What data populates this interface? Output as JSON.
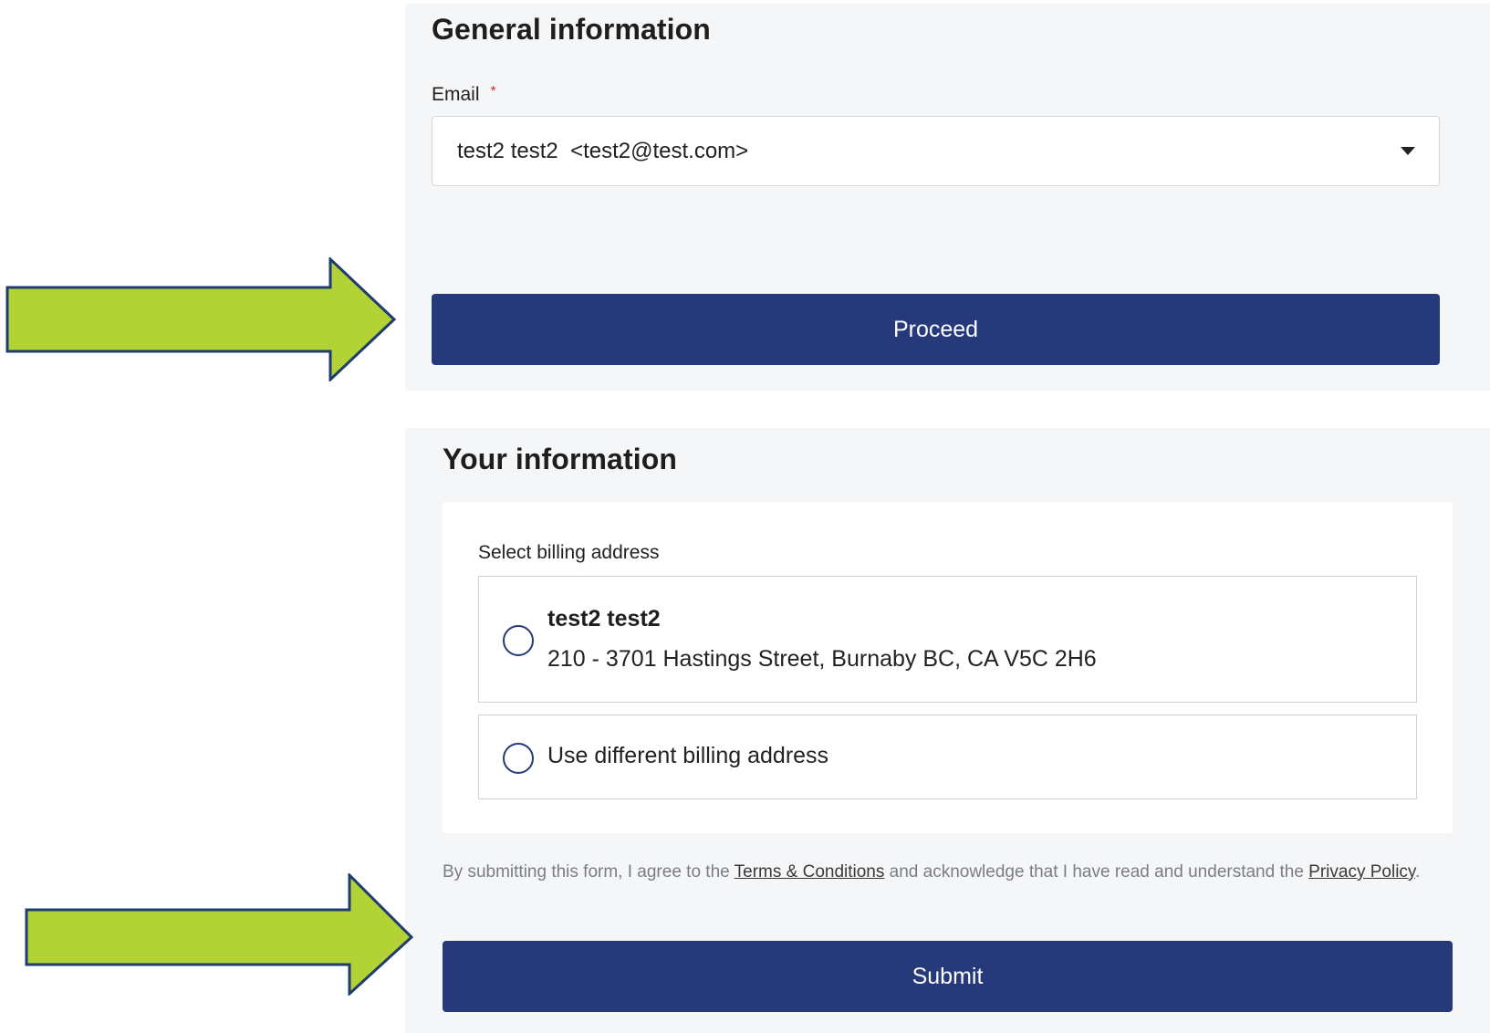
{
  "general": {
    "title": "General information",
    "email_label": "Email",
    "required_mark": "*",
    "email_value": "test2 test2  <test2@test.com>",
    "proceed_label": "Proceed"
  },
  "your_info": {
    "title": "Your information",
    "billing_label": "Select billing address",
    "options": [
      {
        "name": "test2 test2",
        "address": "210 - 3701 Hastings Street, Burnaby BC, CA V5C 2H6"
      },
      {
        "label": "Use different billing address"
      }
    ],
    "consent": {
      "prefix": "By submitting this form, I agree to the ",
      "terms_link": "Terms & Conditions",
      "middle": " and acknowledge that I have read and understand the ",
      "privacy_link": "Privacy Policy",
      "suffix": "."
    },
    "submit_label": "Submit"
  },
  "colors": {
    "primary": "#26397a",
    "arrow_fill": "#b2d235",
    "arrow_stroke": "#1f3c6e",
    "panel_bg": "#f5f6f8"
  },
  "annotations": [
    {
      "icon": "arrow-right-icon",
      "target": "proceed-button"
    },
    {
      "icon": "arrow-right-icon",
      "target": "submit-button"
    }
  ]
}
